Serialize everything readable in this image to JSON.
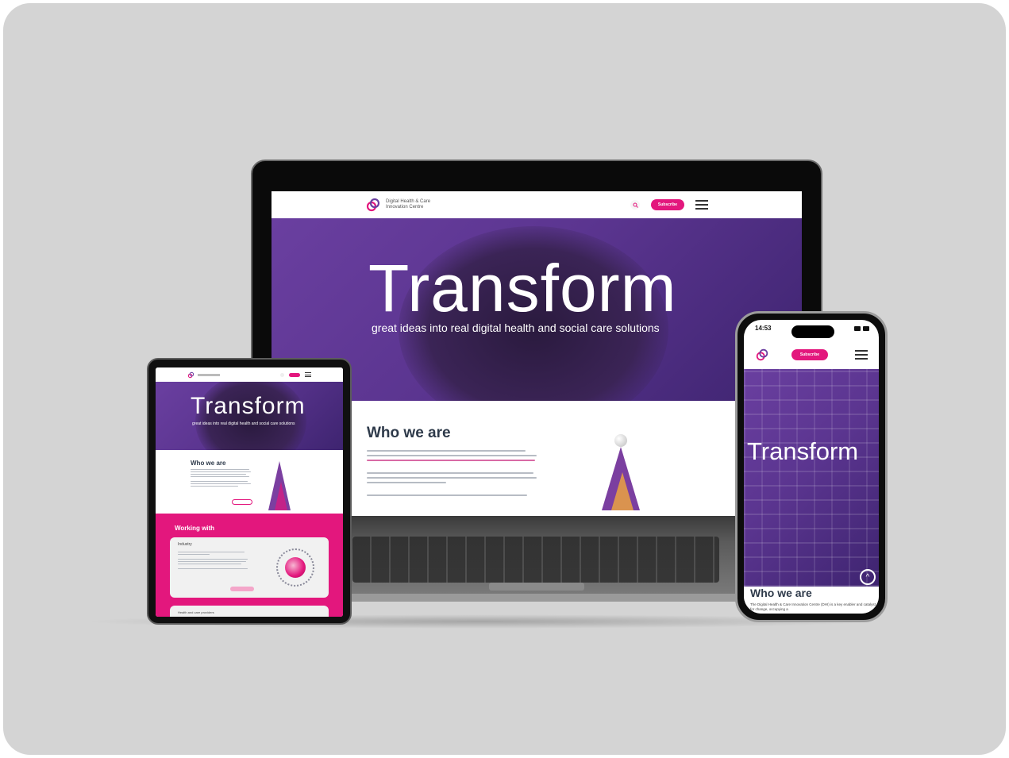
{
  "colors": {
    "panel_bg": "#d4d4d4",
    "brand_pink": "#e3177d",
    "hero_purple": "#5b3590",
    "heading_dark": "#2e3a4a"
  },
  "laptop": {
    "logo_line1": "Digital Health & Care",
    "logo_line2": "Innovation Centre",
    "search_icon": "search-icon",
    "subscribe_label": "Subscribe",
    "hero_title": "Transform",
    "hero_subtitle": "great ideas into real digital health and social care solutions",
    "who_title": "Who we are"
  },
  "tablet": {
    "hero_title": "Transform",
    "hero_subtitle": "great ideas into real digital health and social care solutions",
    "who_title": "Who we are",
    "working_title": "Working with",
    "card1_title": "Industry",
    "card2_title": "Health and care providers"
  },
  "phone": {
    "time": "14:53",
    "subscribe_label": "Subscribe",
    "hero_title": "Transform",
    "who_title": "Who we are",
    "who_text": "The Digital Health & Care Innovation Centre (DHI) is a key enabler and catalyst for change, occupying a"
  }
}
